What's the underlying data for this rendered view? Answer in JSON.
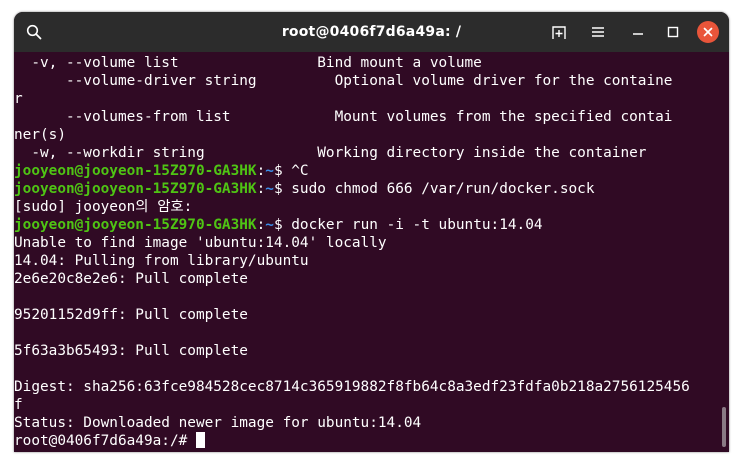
{
  "window": {
    "title": "root@0406f7d6a49a: /"
  },
  "lines": [
    {
      "type": "out",
      "text": "  -v, --volume list                Bind mount a volume"
    },
    {
      "type": "out",
      "text": "      --volume-driver string         Optional volume driver for the containe"
    },
    {
      "type": "out",
      "text": "r"
    },
    {
      "type": "out",
      "text": "      --volumes-from list            Mount volumes from the specified contai"
    },
    {
      "type": "out",
      "text": "ner(s)"
    },
    {
      "type": "out",
      "text": "  -w, --workdir string             Working directory inside the container"
    },
    {
      "type": "prompt",
      "user": "jooyeon@jooyeon-15Z970-GA3HK",
      "sep": ":",
      "path": "~",
      "sym": "$ ",
      "cmd": "^C"
    },
    {
      "type": "prompt",
      "user": "jooyeon@jooyeon-15Z970-GA3HK",
      "sep": ":",
      "path": "~",
      "sym": "$ ",
      "cmd": "sudo chmod 666 /var/run/docker.sock"
    },
    {
      "type": "out",
      "text": "[sudo] jooyeon의 암호:"
    },
    {
      "type": "prompt",
      "user": "jooyeon@jooyeon-15Z970-GA3HK",
      "sep": ":",
      "path": "~",
      "sym": "$ ",
      "cmd": "docker run -i -t ubuntu:14.04"
    },
    {
      "type": "out",
      "text": "Unable to find image 'ubuntu:14.04' locally"
    },
    {
      "type": "out",
      "text": "14.04: Pulling from library/ubuntu"
    },
    {
      "type": "out",
      "text": "2e6e20c8e2e6: Pull complete"
    },
    {
      "type": "out",
      "text": ""
    },
    {
      "type": "out",
      "text": "95201152d9ff: Pull complete"
    },
    {
      "type": "out",
      "text": ""
    },
    {
      "type": "out",
      "text": "5f63a3b65493: Pull complete"
    },
    {
      "type": "out",
      "text": ""
    },
    {
      "type": "out",
      "text": "Digest: sha256:63fce984528cec8714c365919882f8fb64c8a3edf23fdfa0b218a2756125456"
    },
    {
      "type": "out",
      "text": "f"
    },
    {
      "type": "out",
      "text": "Status: Downloaded newer image for ubuntu:14.04"
    },
    {
      "type": "out",
      "text": "root@0406f7d6a49a:/# "
    }
  ],
  "colors": {
    "background": "#300a24",
    "prompt_user": "#4fc414",
    "prompt_path": "#3b8eea",
    "titlebar": "#2c2c2c",
    "close": "#e9553a"
  },
  "icons": {
    "search": "search-icon",
    "new_tab": "new-tab-icon",
    "menu": "hamburger-menu-icon",
    "minimize": "minimize-icon",
    "maximize": "maximize-icon",
    "close": "close-icon"
  }
}
